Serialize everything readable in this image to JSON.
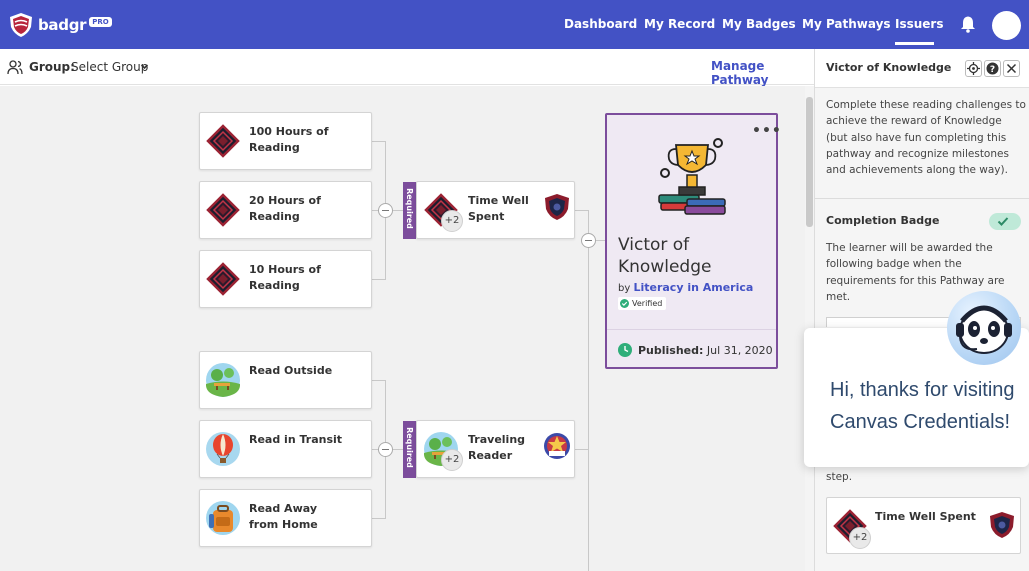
{
  "app": {
    "logo_text": "badgr",
    "logo_badge": "PRO"
  },
  "nav": {
    "items": [
      {
        "label": "Dashboard",
        "active": false
      },
      {
        "label": "My Record",
        "active": false
      },
      {
        "label": "My Badges",
        "active": false
      },
      {
        "label": "My Pathways",
        "active": false
      },
      {
        "label": "Issuers",
        "active": true
      }
    ],
    "notification_icon": "bell-icon",
    "avatar_icon": "user-avatar"
  },
  "toolbar": {
    "group_label": "Group:",
    "group_value": "Select Group",
    "manage_pathway": "Manage Pathway"
  },
  "pathway": {
    "reading_group": {
      "tab_label": "Required",
      "children": [
        {
          "title": "100 Hours of Reading",
          "icon": "shield-badge-icon"
        },
        {
          "title": "20 Hours of Reading",
          "icon": "shield-badge-icon"
        },
        {
          "title": "10 Hours of Reading",
          "icon": "shield-badge-icon"
        }
      ],
      "node": {
        "title": "Time Well Spent",
        "extra_count": "+2",
        "icon": "shield-badge-icon",
        "badge_icon": "crest-icon"
      }
    },
    "travel_group": {
      "tab_label": "Required",
      "children": [
        {
          "title": "Read Outside",
          "icon": "park-icon"
        },
        {
          "title": "Read in Transit",
          "icon": "hot-air-balloon-icon"
        },
        {
          "title": "Read Away from Home",
          "icon": "backpack-icon"
        }
      ],
      "node": {
        "title": "Traveling Reader",
        "extra_count": "+2",
        "icon": "park-icon",
        "badge_icon": "star-badge-icon"
      }
    },
    "goal": {
      "menu": "•••",
      "icon": "trophy-books-icon",
      "title": "Victor of Knowledge",
      "by_prefix": "by",
      "issuer": "Literacy in America",
      "verified": "Verified",
      "published_label": "Published:",
      "published_date": "Jul 31, 2020"
    }
  },
  "panel": {
    "title": "Victor of Knowledge",
    "description": "Complete these reading challenges to achieve the reward of Knowledge (but also have fun completing this pathway and recognize milestones and achievements along the way).",
    "completion_badge_title": "Completion Badge",
    "completion_badge_enabled": true,
    "completion_desc": "The learner will be awarded the following badge when the requirements for this Pathway are met.",
    "step_text": "step.",
    "card": {
      "title": "Time Well Spent",
      "extra_count": "+2"
    }
  },
  "chat": {
    "message": "Hi, thanks for visiting Canvas Credentials!",
    "bot_icon": "panda-headset-icon"
  },
  "colors": {
    "nav_bg": "#4352c5",
    "accent": "#4352c5",
    "required_tab": "#7c4d9c",
    "goal_card_bg": "#efe9f3",
    "toggle_on": "#bfe9d8",
    "chat_text": "#2f4a6d"
  }
}
